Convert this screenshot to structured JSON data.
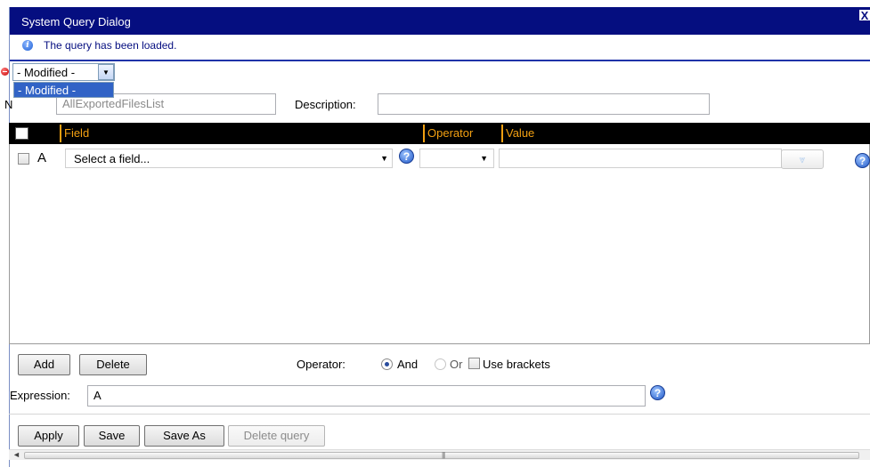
{
  "dialog": {
    "title": "System Query Dialog",
    "close_label": "X",
    "info_message": "The query has been loaded."
  },
  "query_status": {
    "selected": "- Modified -",
    "options": [
      "- Modified -"
    ]
  },
  "name_field": {
    "label": "N",
    "value": "AllExportedFilesList"
  },
  "description_field": {
    "label": "Description:",
    "value": ""
  },
  "grid": {
    "columns": [
      "Field",
      "Operator",
      "Value"
    ],
    "rows": [
      {
        "letter": "A",
        "field_placeholder": "Select a field...",
        "operator": "",
        "value": ""
      }
    ]
  },
  "actions": {
    "add_label": "Add",
    "delete_label": "Delete"
  },
  "operator_options": {
    "label": "Operator:",
    "and_label": "And",
    "or_label": "Or",
    "brackets_label": "Use brackets",
    "selected": "And"
  },
  "expression": {
    "label": "Expression:",
    "value": "A"
  },
  "footer": {
    "apply_label": "Apply",
    "save_label": "Save",
    "save_as_label": "Save As",
    "delete_query_label": "Delete query"
  },
  "icons": {
    "help": "?",
    "info": "i",
    "dropdown": "▼",
    "picker": "⩔",
    "scroll_left": "◄",
    "scroll_grip": "|||"
  },
  "colors": {
    "titlebar": "#050e80",
    "header_bg": "#000000",
    "header_text": "#f2a012",
    "selection": "#3163c6"
  }
}
